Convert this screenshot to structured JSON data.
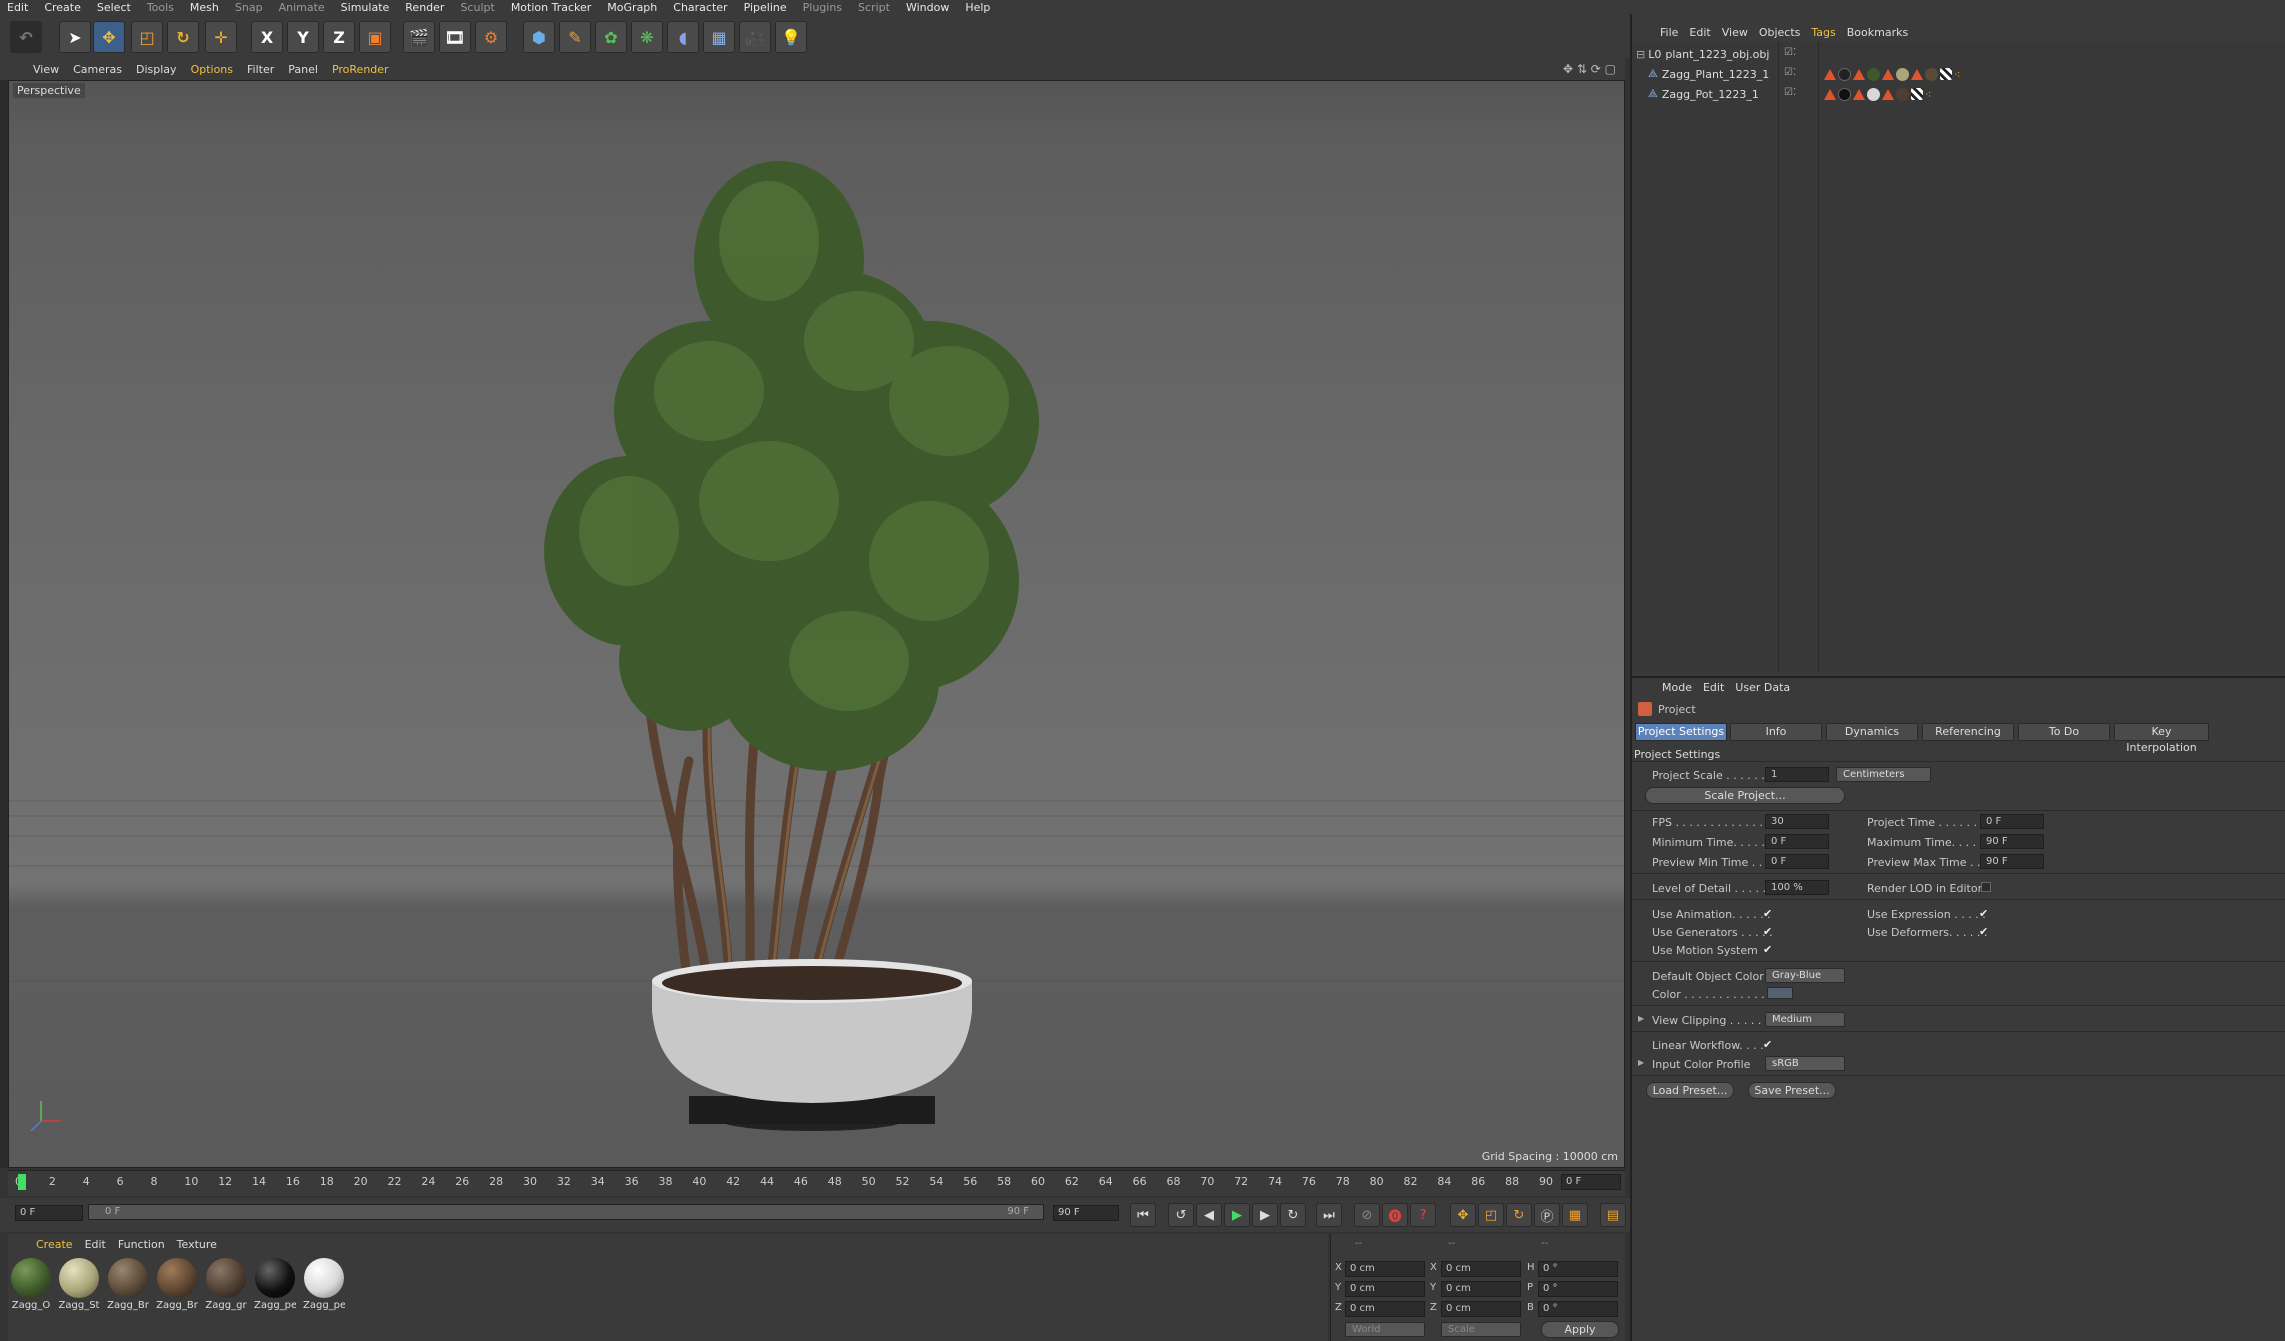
{
  "menu": [
    "Edit",
    "Create",
    "Select",
    "Tools",
    "Mesh",
    "Snap",
    "Animate",
    "Simulate",
    "Render",
    "Sculpt",
    "Motion Tracker",
    "MoGraph",
    "Character",
    "Pipeline",
    "Plugins",
    "Script",
    "Window",
    "Help"
  ],
  "viewport": {
    "menu": [
      "View",
      "Cameras",
      "Display",
      "Options",
      "Filter",
      "Panel",
      "ProRender"
    ],
    "label": "Perspective",
    "grid_spacing": "Grid Spacing : 10000 cm"
  },
  "timeline": {
    "ticks": [
      "0",
      "2",
      "4",
      "6",
      "8",
      "10",
      "12",
      "14",
      "16",
      "18",
      "20",
      "22",
      "24",
      "26",
      "28",
      "30",
      "32",
      "34",
      "36",
      "38",
      "40",
      "42",
      "44",
      "46",
      "48",
      "50",
      "52",
      "54",
      "56",
      "58",
      "60",
      "62",
      "64",
      "66",
      "68",
      "70",
      "72",
      "74",
      "76",
      "78",
      "80",
      "82",
      "84",
      "86",
      "88",
      "90"
    ],
    "current_frame": "0 F",
    "start": "0 F",
    "range_start": "0 F",
    "range_end": "90 F",
    "end": "90 F"
  },
  "materials": {
    "menu": [
      "Create",
      "Edit",
      "Function",
      "Texture"
    ],
    "items": [
      {
        "label": "Zagg_O",
        "color": "#3f5a2a"
      },
      {
        "label": "Zagg_St",
        "color": "#a9a67a"
      },
      {
        "label": "Zagg_Br",
        "color": "#5a4a38"
      },
      {
        "label": "Zagg_Br",
        "color": "#5e4631"
      },
      {
        "label": "Zagg_gr",
        "color": "#4f3f33"
      },
      {
        "label": "Zagg_pe",
        "color": "#111111"
      },
      {
        "label": "Zagg_pe",
        "color": "#d8d8d8"
      }
    ]
  },
  "coords": {
    "header": [
      "--",
      "--",
      "--"
    ],
    "rows": [
      {
        "a": "X",
        "av": "0 cm",
        "b": "X",
        "bv": "0 cm",
        "c": "H",
        "cv": "0 °"
      },
      {
        "a": "Y",
        "av": "0 cm",
        "b": "Y",
        "bv": "0 cm",
        "c": "P",
        "cv": "0 °"
      },
      {
        "a": "Z",
        "av": "0 cm",
        "b": "Z",
        "bv": "0 cm",
        "c": "B",
        "cv": "0 °"
      }
    ],
    "world": "World",
    "scale": "Scale",
    "apply": "Apply"
  },
  "objects": {
    "menu": [
      "File",
      "Edit",
      "View",
      "Objects",
      "Tags",
      "Bookmarks"
    ],
    "items": [
      {
        "name": "plant_1223_obj.obj"
      },
      {
        "name": "Zagg_Plant_1223_1"
      },
      {
        "name": "Zagg_Pot_1223_1"
      }
    ]
  },
  "attributes": {
    "menu": [
      "Mode",
      "Edit",
      "User Data"
    ],
    "title": "Project",
    "tabs": [
      "Project Settings",
      "Info",
      "Dynamics",
      "Referencing",
      "To Do",
      "Key Interpolation"
    ],
    "section": "Project Settings",
    "project_scale_label": "Project Scale . . . . . .",
    "project_scale": "1",
    "project_scale_unit": "Centimeters",
    "scale_project": "Scale Project...",
    "fps_label": "FPS . . . . . . . . . . . . . . .",
    "fps": "30",
    "project_time_label": "Project Time . . . . . . . .",
    "project_time": "0 F",
    "min_time_label": "Minimum Time. . . . . . .",
    "min_time": "0 F",
    "max_time_label": "Maximum Time. . . . . .",
    "max_time": "90 F",
    "prev_min_label": "Preview Min Time . . .",
    "prev_min": "0 F",
    "prev_max_label": "Preview Max Time . . .",
    "prev_max": "90 F",
    "lod_label": "Level of Detail . . . . . .",
    "lod": "100 %",
    "render_lod_label": "Render LOD in Editor",
    "use_animation": "Use Animation. . . . . .",
    "use_expression": "Use Expression . . . . .",
    "use_generators": "Use Generators . . . . .",
    "use_deformers": "Use Deformers. . . . . .",
    "use_motion": "Use Motion System",
    "default_color_label": "Default Object Color",
    "default_color": "Gray-Blue",
    "color_label": "Color . . . . . . . . . . . . .",
    "view_clipping_label": "View Clipping . . . . . .",
    "view_clipping": "Medium",
    "linear_workflow": "Linear Workflow. . . .",
    "input_profile_label": "Input Color Profile",
    "input_profile": "sRGB",
    "load_preset": "Load Preset...",
    "save_preset": "Save Preset..."
  },
  "colors": {
    "accent": "#5d82b8",
    "highlight": "#f0c040",
    "playhead": "#44dd66"
  }
}
